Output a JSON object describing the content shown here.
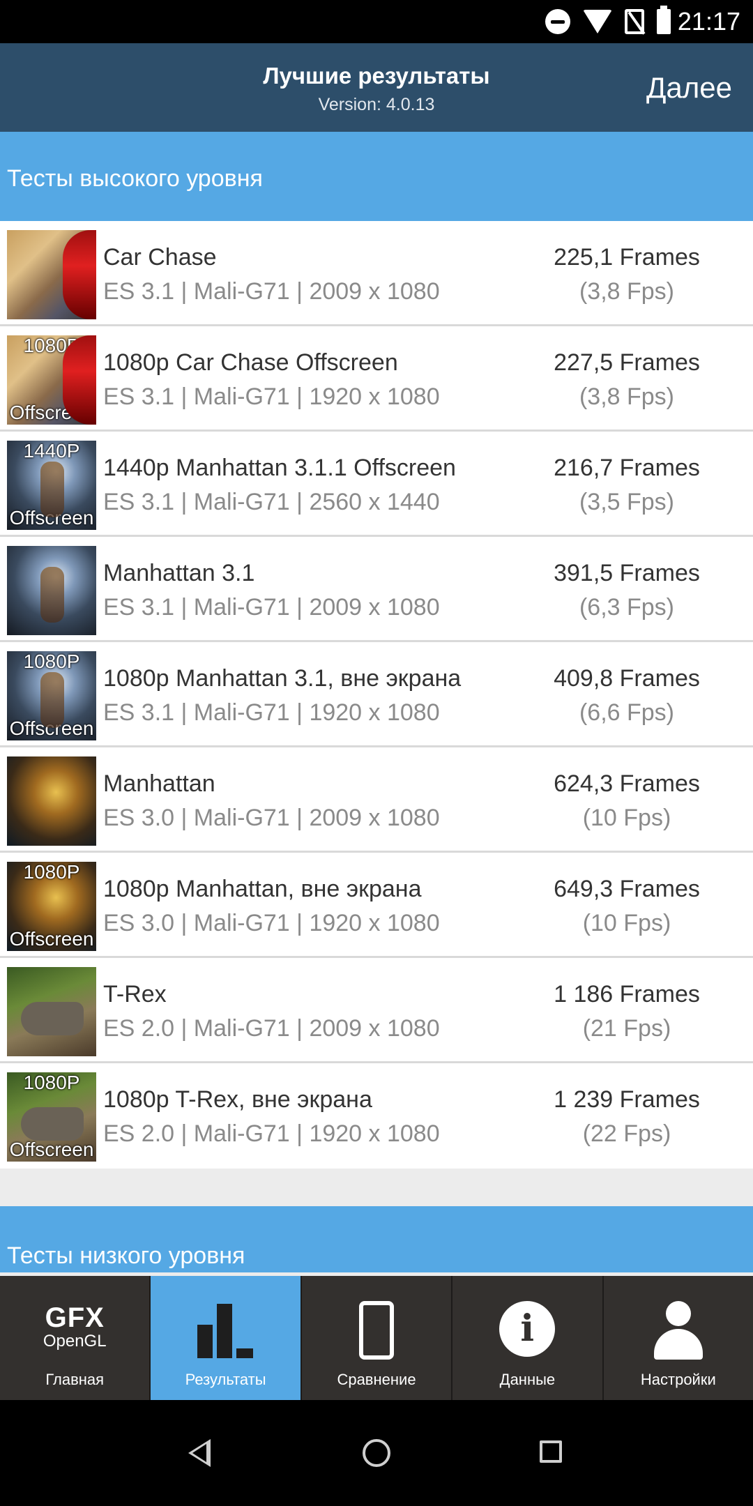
{
  "status_bar": {
    "time": "21:17"
  },
  "app_bar": {
    "title": "Лучшие результаты",
    "version": "Version: 4.0.13",
    "next_label": "Далее"
  },
  "sections": {
    "high": "Тесты высокого уровня",
    "low": "Тесты низкого уровня"
  },
  "tests": [
    {
      "name": "Car Chase",
      "details": "ES 3.1 | Mali-G71 | 2009 x 1080",
      "frames": "225,1 Frames",
      "fps": "(3,8 Fps)",
      "thumb_top": "",
      "thumb_bottom": ""
    },
    {
      "name": "1080p Car Chase Offscreen",
      "details": "ES 3.1 | Mali-G71 | 1920 x 1080",
      "frames": "227,5 Frames",
      "fps": "(3,8 Fps)",
      "thumb_top": "1080P",
      "thumb_bottom": "Offscreen"
    },
    {
      "name": "1440p Manhattan 3.1.1 Offscreen",
      "details": "ES 3.1 | Mali-G71 | 2560 x 1440",
      "frames": "216,7 Frames",
      "fps": "(3,5 Fps)",
      "thumb_top": "1440P",
      "thumb_bottom": "Offscreen"
    },
    {
      "name": "Manhattan 3.1",
      "details": "ES 3.1 | Mali-G71 | 2009 x 1080",
      "frames": "391,5 Frames",
      "fps": "(6,3 Fps)",
      "thumb_top": "",
      "thumb_bottom": ""
    },
    {
      "name": "1080p Manhattan 3.1, вне экрана",
      "details": "ES 3.1 | Mali-G71 | 1920 x 1080",
      "frames": "409,8 Frames",
      "fps": "(6,6 Fps)",
      "thumb_top": "1080P",
      "thumb_bottom": "Offscreen"
    },
    {
      "name": "Manhattan",
      "details": "ES 3.0 | Mali-G71 | 2009 x 1080",
      "frames": "624,3 Frames",
      "fps": "(10 Fps)",
      "thumb_top": "",
      "thumb_bottom": ""
    },
    {
      "name": "1080p Manhattan, вне экрана",
      "details": "ES 3.0 | Mali-G71 | 1920 x 1080",
      "frames": "649,3 Frames",
      "fps": "(10 Fps)",
      "thumb_top": "1080P",
      "thumb_bottom": "Offscreen"
    },
    {
      "name": "T-Rex",
      "details": "ES 2.0 | Mali-G71 | 2009 x 1080",
      "frames": "1 186 Frames",
      "fps": "(21 Fps)",
      "thumb_top": "",
      "thumb_bottom": ""
    },
    {
      "name": "1080p T-Rex, вне экрана",
      "details": "ES 2.0 | Mali-G71 | 1920 x 1080",
      "frames": "1 239 Frames",
      "fps": "(22 Fps)",
      "thumb_top": "1080P",
      "thumb_bottom": "Offscreen"
    }
  ],
  "bottom_nav": {
    "home_logo_1": "GFX",
    "home_logo_2": "OpenGL",
    "items": [
      {
        "label": "Главная",
        "icon": "gfx-logo-icon"
      },
      {
        "label": "Результаты",
        "icon": "bar-chart-icon",
        "active": true
      },
      {
        "label": "Сравнение",
        "icon": "phone-icon"
      },
      {
        "label": "Данные",
        "icon": "info-icon"
      },
      {
        "label": "Настройки",
        "icon": "person-icon"
      }
    ]
  },
  "colors": {
    "app_bar": "#2d4e6a",
    "section_header": "#55a8e4",
    "active_tab": "#55a8e4",
    "bottom_nav": "#33302e"
  }
}
